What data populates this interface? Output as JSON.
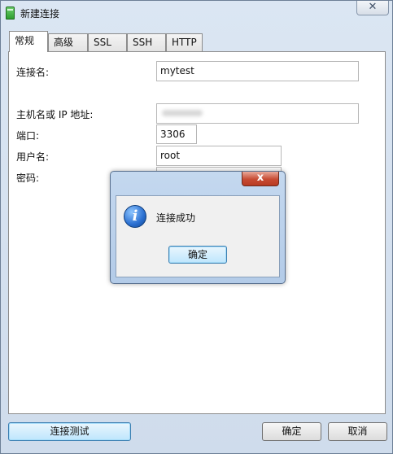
{
  "window": {
    "title": "新建连接",
    "close_glyph": "✕",
    "icon": "database-icon"
  },
  "tabs": [
    {
      "label": "常规",
      "active": true
    },
    {
      "label": "高级",
      "active": false
    },
    {
      "label": "SSL",
      "active": false
    },
    {
      "label": "SSH",
      "active": false
    },
    {
      "label": "HTTP",
      "active": false
    }
  ],
  "form": {
    "connection_name_label": "连接名:",
    "connection_name_value": "mytest",
    "host_label": "主机名或 IP 地址:",
    "host_value": "",
    "port_label": "端口:",
    "port_value": "3306",
    "username_label": "用户名:",
    "username_value": "root",
    "password_label": "密码:"
  },
  "buttons": {
    "test_connection": "连接测试",
    "ok": "确定",
    "cancel": "取消"
  },
  "dialog": {
    "message": "连接成功",
    "ok_label": "确定",
    "close_glyph": "x",
    "icon": "info-icon",
    "icon_glyph": "i"
  }
}
